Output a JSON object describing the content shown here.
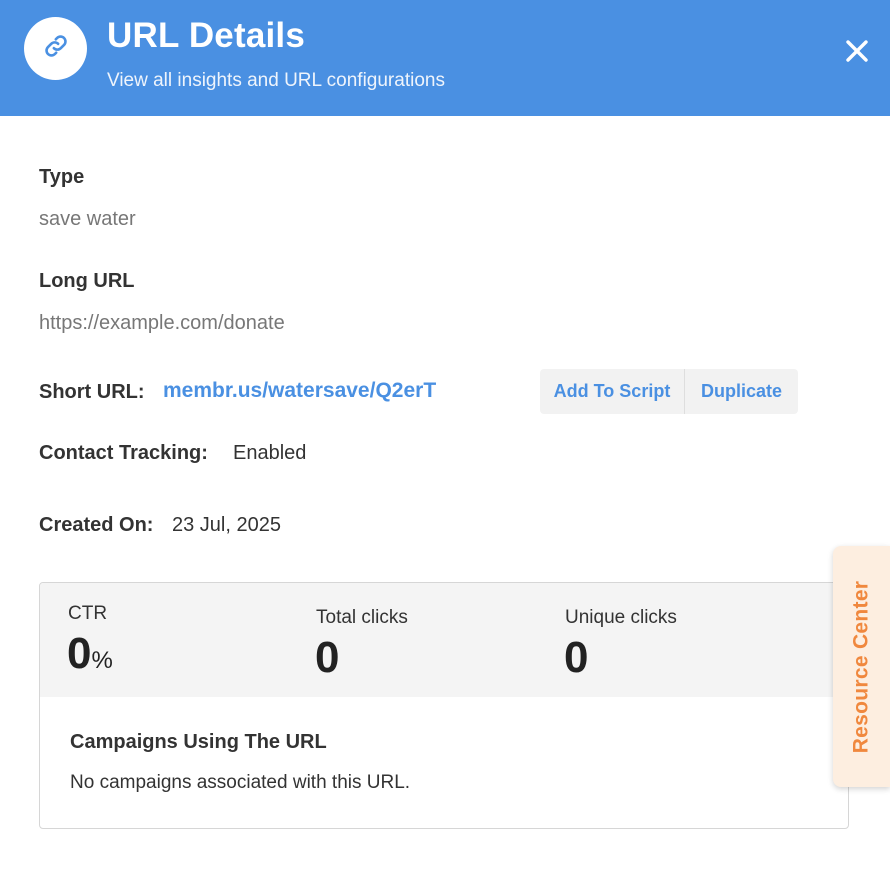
{
  "header": {
    "title": "URL Details",
    "subtitle": "View all insights and URL configurations",
    "icon": "link-icon",
    "close_icon": "close-icon",
    "background_color": "#4a90e2"
  },
  "details": {
    "type_label": "Type",
    "type_value": "save water",
    "long_url_label": "Long URL",
    "long_url_value": "https://example.com/donate",
    "short_url_label": "Short URL:",
    "short_url_value": "membr.us/watersave/Q2erT",
    "add_to_script_label": "Add To Script",
    "duplicate_label": "Duplicate",
    "contact_tracking_label": "Contact Tracking:",
    "contact_tracking_value": "Enabled",
    "created_on_label": "Created On:",
    "created_on_value": "23 Jul, 2025"
  },
  "stats": {
    "ctr_label": "CTR",
    "ctr_value": "0",
    "ctr_unit": "%",
    "total_clicks_label": "Total clicks",
    "total_clicks_value": "0",
    "unique_clicks_label": "Unique clicks",
    "unique_clicks_value": "0"
  },
  "campaigns": {
    "title": "Campaigns Using The URL",
    "empty_message": "No campaigns associated with this URL."
  },
  "resource_center": {
    "label": "Resource Center",
    "accent_color": "#f0883e"
  }
}
